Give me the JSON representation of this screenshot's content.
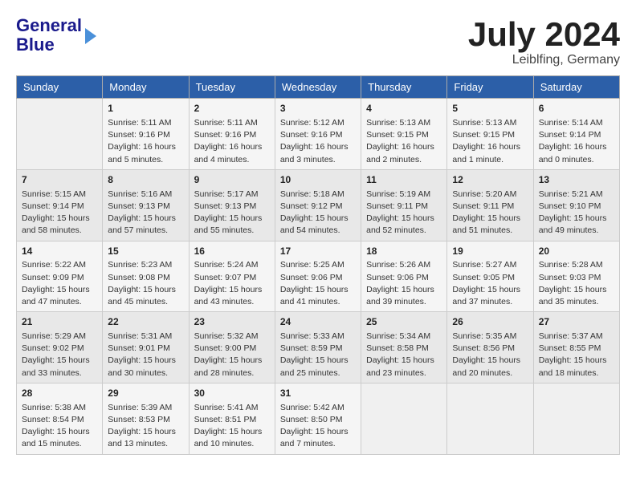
{
  "logo": {
    "line1": "General",
    "line2": "Blue"
  },
  "title": "July 2024",
  "location": "Leiblfing, Germany",
  "days_of_week": [
    "Sunday",
    "Monday",
    "Tuesday",
    "Wednesday",
    "Thursday",
    "Friday",
    "Saturday"
  ],
  "weeks": [
    [
      {
        "day": "",
        "info": ""
      },
      {
        "day": "1",
        "info": "Sunrise: 5:11 AM\nSunset: 9:16 PM\nDaylight: 16 hours\nand 5 minutes."
      },
      {
        "day": "2",
        "info": "Sunrise: 5:11 AM\nSunset: 9:16 PM\nDaylight: 16 hours\nand 4 minutes."
      },
      {
        "day": "3",
        "info": "Sunrise: 5:12 AM\nSunset: 9:16 PM\nDaylight: 16 hours\nand 3 minutes."
      },
      {
        "day": "4",
        "info": "Sunrise: 5:13 AM\nSunset: 9:15 PM\nDaylight: 16 hours\nand 2 minutes."
      },
      {
        "day": "5",
        "info": "Sunrise: 5:13 AM\nSunset: 9:15 PM\nDaylight: 16 hours\nand 1 minute."
      },
      {
        "day": "6",
        "info": "Sunrise: 5:14 AM\nSunset: 9:14 PM\nDaylight: 16 hours\nand 0 minutes."
      }
    ],
    [
      {
        "day": "7",
        "info": "Sunrise: 5:15 AM\nSunset: 9:14 PM\nDaylight: 15 hours\nand 58 minutes."
      },
      {
        "day": "8",
        "info": "Sunrise: 5:16 AM\nSunset: 9:13 PM\nDaylight: 15 hours\nand 57 minutes."
      },
      {
        "day": "9",
        "info": "Sunrise: 5:17 AM\nSunset: 9:13 PM\nDaylight: 15 hours\nand 55 minutes."
      },
      {
        "day": "10",
        "info": "Sunrise: 5:18 AM\nSunset: 9:12 PM\nDaylight: 15 hours\nand 54 minutes."
      },
      {
        "day": "11",
        "info": "Sunrise: 5:19 AM\nSunset: 9:11 PM\nDaylight: 15 hours\nand 52 minutes."
      },
      {
        "day": "12",
        "info": "Sunrise: 5:20 AM\nSunset: 9:11 PM\nDaylight: 15 hours\nand 51 minutes."
      },
      {
        "day": "13",
        "info": "Sunrise: 5:21 AM\nSunset: 9:10 PM\nDaylight: 15 hours\nand 49 minutes."
      }
    ],
    [
      {
        "day": "14",
        "info": "Sunrise: 5:22 AM\nSunset: 9:09 PM\nDaylight: 15 hours\nand 47 minutes."
      },
      {
        "day": "15",
        "info": "Sunrise: 5:23 AM\nSunset: 9:08 PM\nDaylight: 15 hours\nand 45 minutes."
      },
      {
        "day": "16",
        "info": "Sunrise: 5:24 AM\nSunset: 9:07 PM\nDaylight: 15 hours\nand 43 minutes."
      },
      {
        "day": "17",
        "info": "Sunrise: 5:25 AM\nSunset: 9:06 PM\nDaylight: 15 hours\nand 41 minutes."
      },
      {
        "day": "18",
        "info": "Sunrise: 5:26 AM\nSunset: 9:06 PM\nDaylight: 15 hours\nand 39 minutes."
      },
      {
        "day": "19",
        "info": "Sunrise: 5:27 AM\nSunset: 9:05 PM\nDaylight: 15 hours\nand 37 minutes."
      },
      {
        "day": "20",
        "info": "Sunrise: 5:28 AM\nSunset: 9:03 PM\nDaylight: 15 hours\nand 35 minutes."
      }
    ],
    [
      {
        "day": "21",
        "info": "Sunrise: 5:29 AM\nSunset: 9:02 PM\nDaylight: 15 hours\nand 33 minutes."
      },
      {
        "day": "22",
        "info": "Sunrise: 5:31 AM\nSunset: 9:01 PM\nDaylight: 15 hours\nand 30 minutes."
      },
      {
        "day": "23",
        "info": "Sunrise: 5:32 AM\nSunset: 9:00 PM\nDaylight: 15 hours\nand 28 minutes."
      },
      {
        "day": "24",
        "info": "Sunrise: 5:33 AM\nSunset: 8:59 PM\nDaylight: 15 hours\nand 25 minutes."
      },
      {
        "day": "25",
        "info": "Sunrise: 5:34 AM\nSunset: 8:58 PM\nDaylight: 15 hours\nand 23 minutes."
      },
      {
        "day": "26",
        "info": "Sunrise: 5:35 AM\nSunset: 8:56 PM\nDaylight: 15 hours\nand 20 minutes."
      },
      {
        "day": "27",
        "info": "Sunrise: 5:37 AM\nSunset: 8:55 PM\nDaylight: 15 hours\nand 18 minutes."
      }
    ],
    [
      {
        "day": "28",
        "info": "Sunrise: 5:38 AM\nSunset: 8:54 PM\nDaylight: 15 hours\nand 15 minutes."
      },
      {
        "day": "29",
        "info": "Sunrise: 5:39 AM\nSunset: 8:53 PM\nDaylight: 15 hours\nand 13 minutes."
      },
      {
        "day": "30",
        "info": "Sunrise: 5:41 AM\nSunset: 8:51 PM\nDaylight: 15 hours\nand 10 minutes."
      },
      {
        "day": "31",
        "info": "Sunrise: 5:42 AM\nSunset: 8:50 PM\nDaylight: 15 hours\nand 7 minutes."
      },
      {
        "day": "",
        "info": ""
      },
      {
        "day": "",
        "info": ""
      },
      {
        "day": "",
        "info": ""
      }
    ]
  ]
}
